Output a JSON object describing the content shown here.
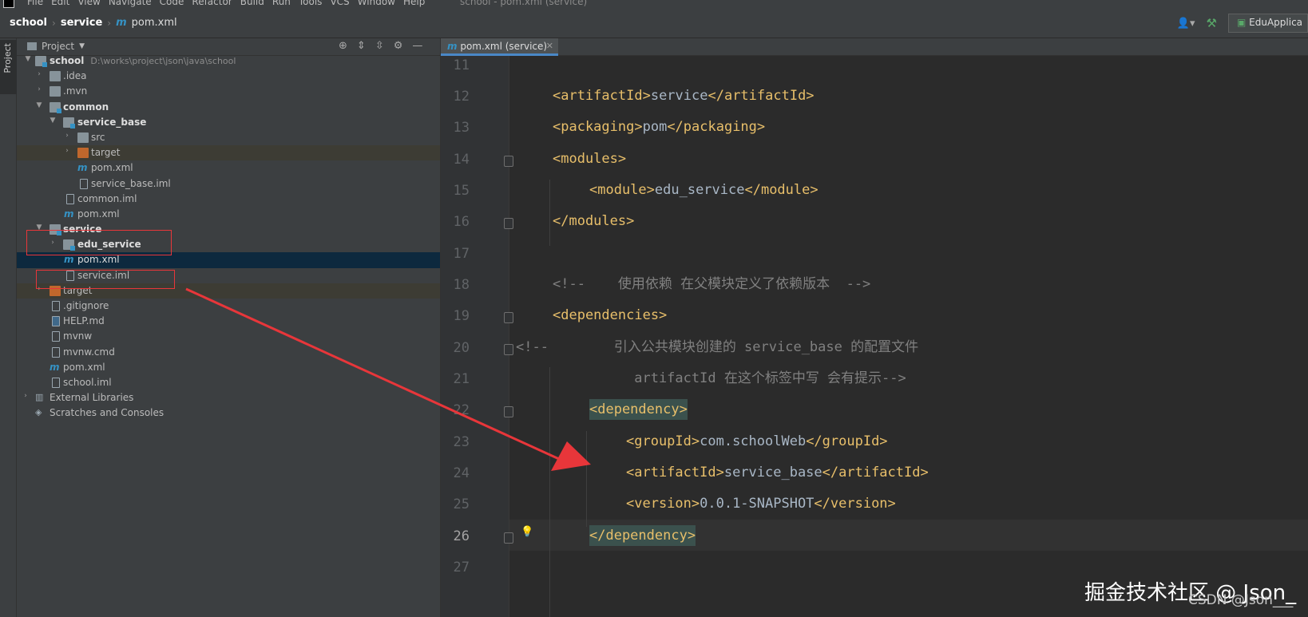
{
  "menu": {
    "items": [
      "File",
      "Edit",
      "View",
      "Navigate",
      "Code",
      "Refactor",
      "Build",
      "Run",
      "Tools",
      "VCS",
      "Window",
      "Help"
    ],
    "window_title": "school - pom.xml (service)"
  },
  "navbar": {
    "crumbs": [
      "school",
      "service",
      "pom.xml"
    ],
    "run_config": "EduApplica"
  },
  "stripe": {
    "project_tab": "Project"
  },
  "project_panel": {
    "title": "Project",
    "tree": [
      {
        "label": "school",
        "path": "D:\\works\\project\\json\\java\\school"
      },
      {
        "label": ".idea"
      },
      {
        "label": ".mvn"
      },
      {
        "label": "common"
      },
      {
        "label": "service_base"
      },
      {
        "label": "src"
      },
      {
        "label": "target"
      },
      {
        "label": "pom.xml"
      },
      {
        "label": "service_base.iml"
      },
      {
        "label": "common.iml"
      },
      {
        "label": "pom.xml"
      },
      {
        "label": "service"
      },
      {
        "label": "edu_service"
      },
      {
        "label": "pom.xml"
      },
      {
        "label": "service.iml"
      },
      {
        "label": "target"
      },
      {
        "label": ".gitignore"
      },
      {
        "label": "HELP.md"
      },
      {
        "label": "mvnw"
      },
      {
        "label": "mvnw.cmd"
      },
      {
        "label": "pom.xml"
      },
      {
        "label": "school.iml"
      },
      {
        "label": "External Libraries"
      },
      {
        "label": "Scratches and Consoles"
      }
    ]
  },
  "editor": {
    "tab_label": "pom.xml (service)",
    "line_numbers": [
      "11",
      "12",
      "13",
      "14",
      "15",
      "16",
      "17",
      "18",
      "19",
      "20",
      "21",
      "22",
      "23",
      "24",
      "25",
      "26",
      "27"
    ],
    "lines": {
      "l12_open": "<artifactId>",
      "l12_val": "service",
      "l12_close": "</artifactId>",
      "l13_open": "<packaging>",
      "l13_val": "pom",
      "l13_close": "</packaging>",
      "l14": "<modules>",
      "l15_open": "<module>",
      "l15_val": "edu_service",
      "l15_close": "</module>",
      "l16": "</modules>",
      "l18": "<!--    使用依赖 在父模块定义了依赖版本  -->",
      "l19": "<dependencies>",
      "l20": "<!--        引入公共模块创建的 service_base 的配置文件",
      "l21": " artifactId 在这个标签中写 会有提示-->",
      "l22": "<dependency>",
      "l23_open": "<groupId>",
      "l23_val": "com.schoolWeb",
      "l23_close": "</groupId>",
      "l24_open": "<artifactId>",
      "l24_val": "service_base",
      "l24_close": "</artifactId>",
      "l25_open": "<version>",
      "l25_val": "0.0.1-SNAPSHOT",
      "l25_close": "</version>",
      "l26": "</dependency>"
    }
  },
  "watermark": {
    "main": "掘金技术社区 @ Json_",
    "sub": "CSDN @Json___"
  },
  "colors": {
    "annotation_red": "#e8363a",
    "xml_tag": "#e8bf6a",
    "code_text": "#a9b7c6",
    "comment": "#808080"
  }
}
